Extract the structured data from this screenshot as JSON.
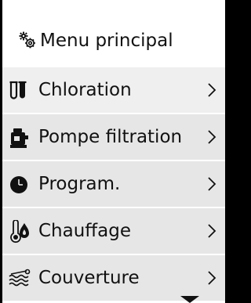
{
  "header": {
    "title": "Menu principal",
    "icon": "gear-icon"
  },
  "menu": {
    "items": [
      {
        "label": "Chloration",
        "icon": "test-tubes-icon",
        "selected": true
      },
      {
        "label": "Pompe filtration",
        "icon": "pump-icon",
        "selected": false
      },
      {
        "label": "Program.",
        "icon": "clock-icon",
        "selected": false
      },
      {
        "label": "Chauffage",
        "icon": "heating-icon",
        "selected": false
      },
      {
        "label": "Couverture",
        "icon": "pool-cover-icon",
        "selected": false
      }
    ]
  },
  "colors": {
    "screen_bg": "#ffffff",
    "row_bg": "#e6e6e6",
    "row_selected_bg": "#efefef",
    "text": "#111111",
    "bezel": "#000000"
  }
}
